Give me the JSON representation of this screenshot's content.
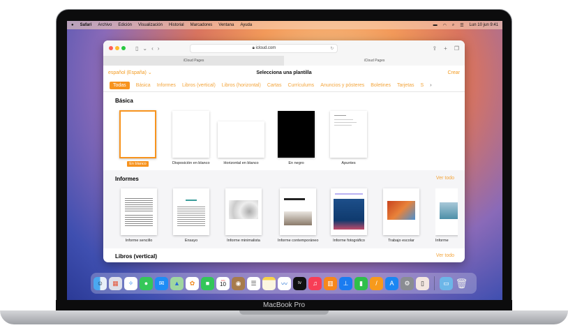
{
  "menubar": {
    "apple": "",
    "app": "Safari",
    "items": [
      "Archivo",
      "Edición",
      "Visualización",
      "Historial",
      "Marcadores",
      "Ventana",
      "Ayuda"
    ],
    "datetime": "Lun 10 jun 9:41"
  },
  "browser": {
    "url": "icloud.com",
    "tabs": [
      "iCloud Pages",
      "iCloud Pages"
    ]
  },
  "page": {
    "language": "español (España)",
    "title": "Selecciona una plantilla",
    "create": "Crear",
    "categories": [
      "Todas",
      "Básica",
      "Informes",
      "Libros (vertical)",
      "Libros (horizontal)",
      "Cartas",
      "Currículums",
      "Anuncios y pósteres",
      "Boletines",
      "Tarjetas",
      "S"
    ],
    "sections": [
      {
        "title": "Básica",
        "items": [
          "En blanco",
          "Disposición en blanco",
          "Horizontal en blanco",
          "En negro",
          "Apuntes"
        ]
      },
      {
        "title": "Informes",
        "see_all": "Ver todo",
        "items": [
          "Informe sencillo",
          "Ensayo",
          "Informe minimalista",
          "Informe contemporáneo",
          "Informe fotográfico",
          "Trabajo escolar",
          "Informe"
        ]
      },
      {
        "title": "Libros (vertical)",
        "see_all": "Ver todo"
      }
    ]
  },
  "dock": {
    "calendar_month": "JUN",
    "calendar_day": "10",
    "tv": "tv",
    "apps": [
      "finder",
      "launchpad",
      "safari",
      "messages",
      "mail",
      "maps",
      "photos",
      "facetime",
      "calendar",
      "contacts",
      "reminders",
      "notes",
      "freeform",
      "tv",
      "music",
      "books",
      "keynote",
      "numbers",
      "pages",
      "app-store",
      "settings",
      "iphone-mirroring"
    ]
  },
  "device": {
    "label": "MacBook Pro"
  }
}
